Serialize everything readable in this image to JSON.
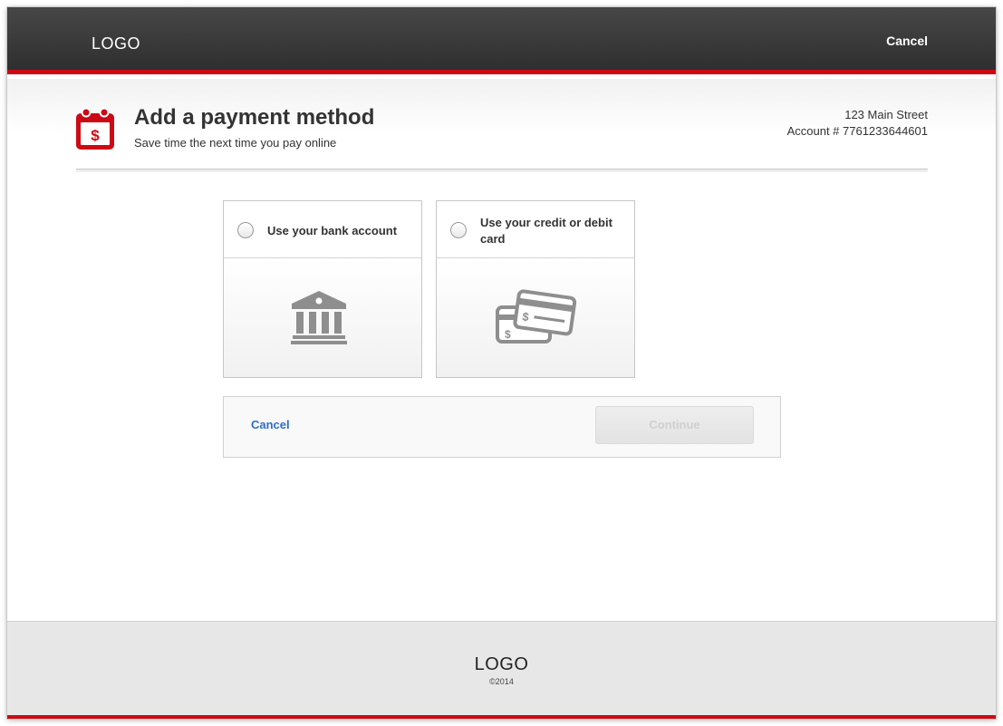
{
  "header": {
    "logo": "LOGO",
    "cancel_label": "Cancel"
  },
  "page": {
    "icon": "calendar-dollar-icon",
    "title": "Add a payment method",
    "subtitle": "Save time the next time you pay online"
  },
  "account": {
    "address": "123 Main Street",
    "account_line": "Account # 7761233644601"
  },
  "options": [
    {
      "label": "Use your bank account",
      "icon": "bank-icon",
      "selected": false
    },
    {
      "label": "Use your credit or debit card",
      "icon": "credit-card-icon",
      "selected": false
    }
  ],
  "actions": {
    "cancel_label": "Cancel",
    "continue_label": "Continue",
    "continue_enabled": false
  },
  "footer": {
    "logo": "LOGO",
    "copyright": "©2014"
  },
  "colors": {
    "accent": "#cc0a15",
    "link": "#2d6ec9",
    "icon_gray": "#8e8e8e"
  }
}
